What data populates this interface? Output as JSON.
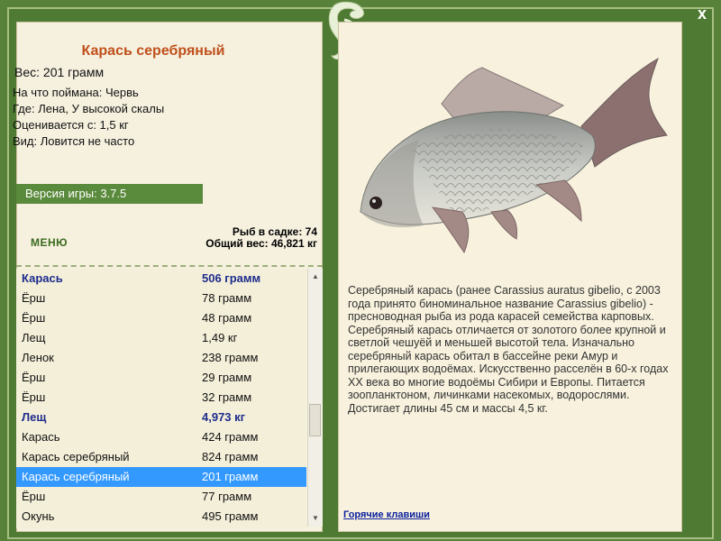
{
  "window": {
    "close_label": "x"
  },
  "fish": {
    "title": "Карась серебряный",
    "weight": "Вес: 201 грамм",
    "bait": "На что поймана: Червь",
    "location": "Где: Лена, У высокой скалы",
    "value": "Оценивается с: 1,5 кг",
    "rarity": "Вид: Ловится не часто"
  },
  "version": "Версия игры: 3.7.5",
  "menu_label": "МЕНЮ",
  "catch": {
    "count": "Рыб в садке: 74",
    "total_weight": "Общий вес: 46,821 кг"
  },
  "list": [
    {
      "name": "Карась",
      "weight": "506 грамм",
      "type": "head"
    },
    {
      "name": "Ёрш",
      "weight": "78 грамм",
      "type": "normal"
    },
    {
      "name": "Ёрш",
      "weight": "48 грамм",
      "type": "normal"
    },
    {
      "name": "Лещ",
      "weight": "1,49 кг",
      "type": "normal"
    },
    {
      "name": "Ленок",
      "weight": "238 грамм",
      "type": "normal"
    },
    {
      "name": "Ёрш",
      "weight": "29 грамм",
      "type": "normal"
    },
    {
      "name": "Ёрш",
      "weight": "32 грамм",
      "type": "normal"
    },
    {
      "name": "Лещ",
      "weight": "4,973 кг",
      "type": "head"
    },
    {
      "name": "Карась",
      "weight": "424 грамм",
      "type": "normal"
    },
    {
      "name": "Карась серебряный",
      "weight": "824 грамм",
      "type": "normal"
    },
    {
      "name": "Карась серебряный",
      "weight": "201 грамм",
      "type": "selected"
    },
    {
      "name": "Ёрш",
      "weight": "77 грамм",
      "type": "normal"
    },
    {
      "name": "Окунь",
      "weight": "495 грамм",
      "type": "normal"
    }
  ],
  "description": "Серебряный карась (ранее Carassius auratus gibelio, с 2003 года принято биноминальное название Carassius gibelio) - пресноводная рыба из рода карасей семейства карповых. Серебряный карась отличается от золотого более крупной и светлой чешуёй и меньшей высотой тела. Изначально серебряный карась обитал в бассейне реки Амур и прилегающих водоёмах. Искусственно расселён в 60-х годах XX века во многие водоёмы Сибири и Европы. Питается зоопланктоном, личинками насекомых, водорослями. Достигает длины 45 см и массы 4,5 кг.",
  "hotkeys_label": "Горячие клавиши",
  "colors": {
    "title": "#c0501b",
    "frame": "#58823a",
    "selection": "#3399ff",
    "list_head": "#1d2c8c"
  }
}
